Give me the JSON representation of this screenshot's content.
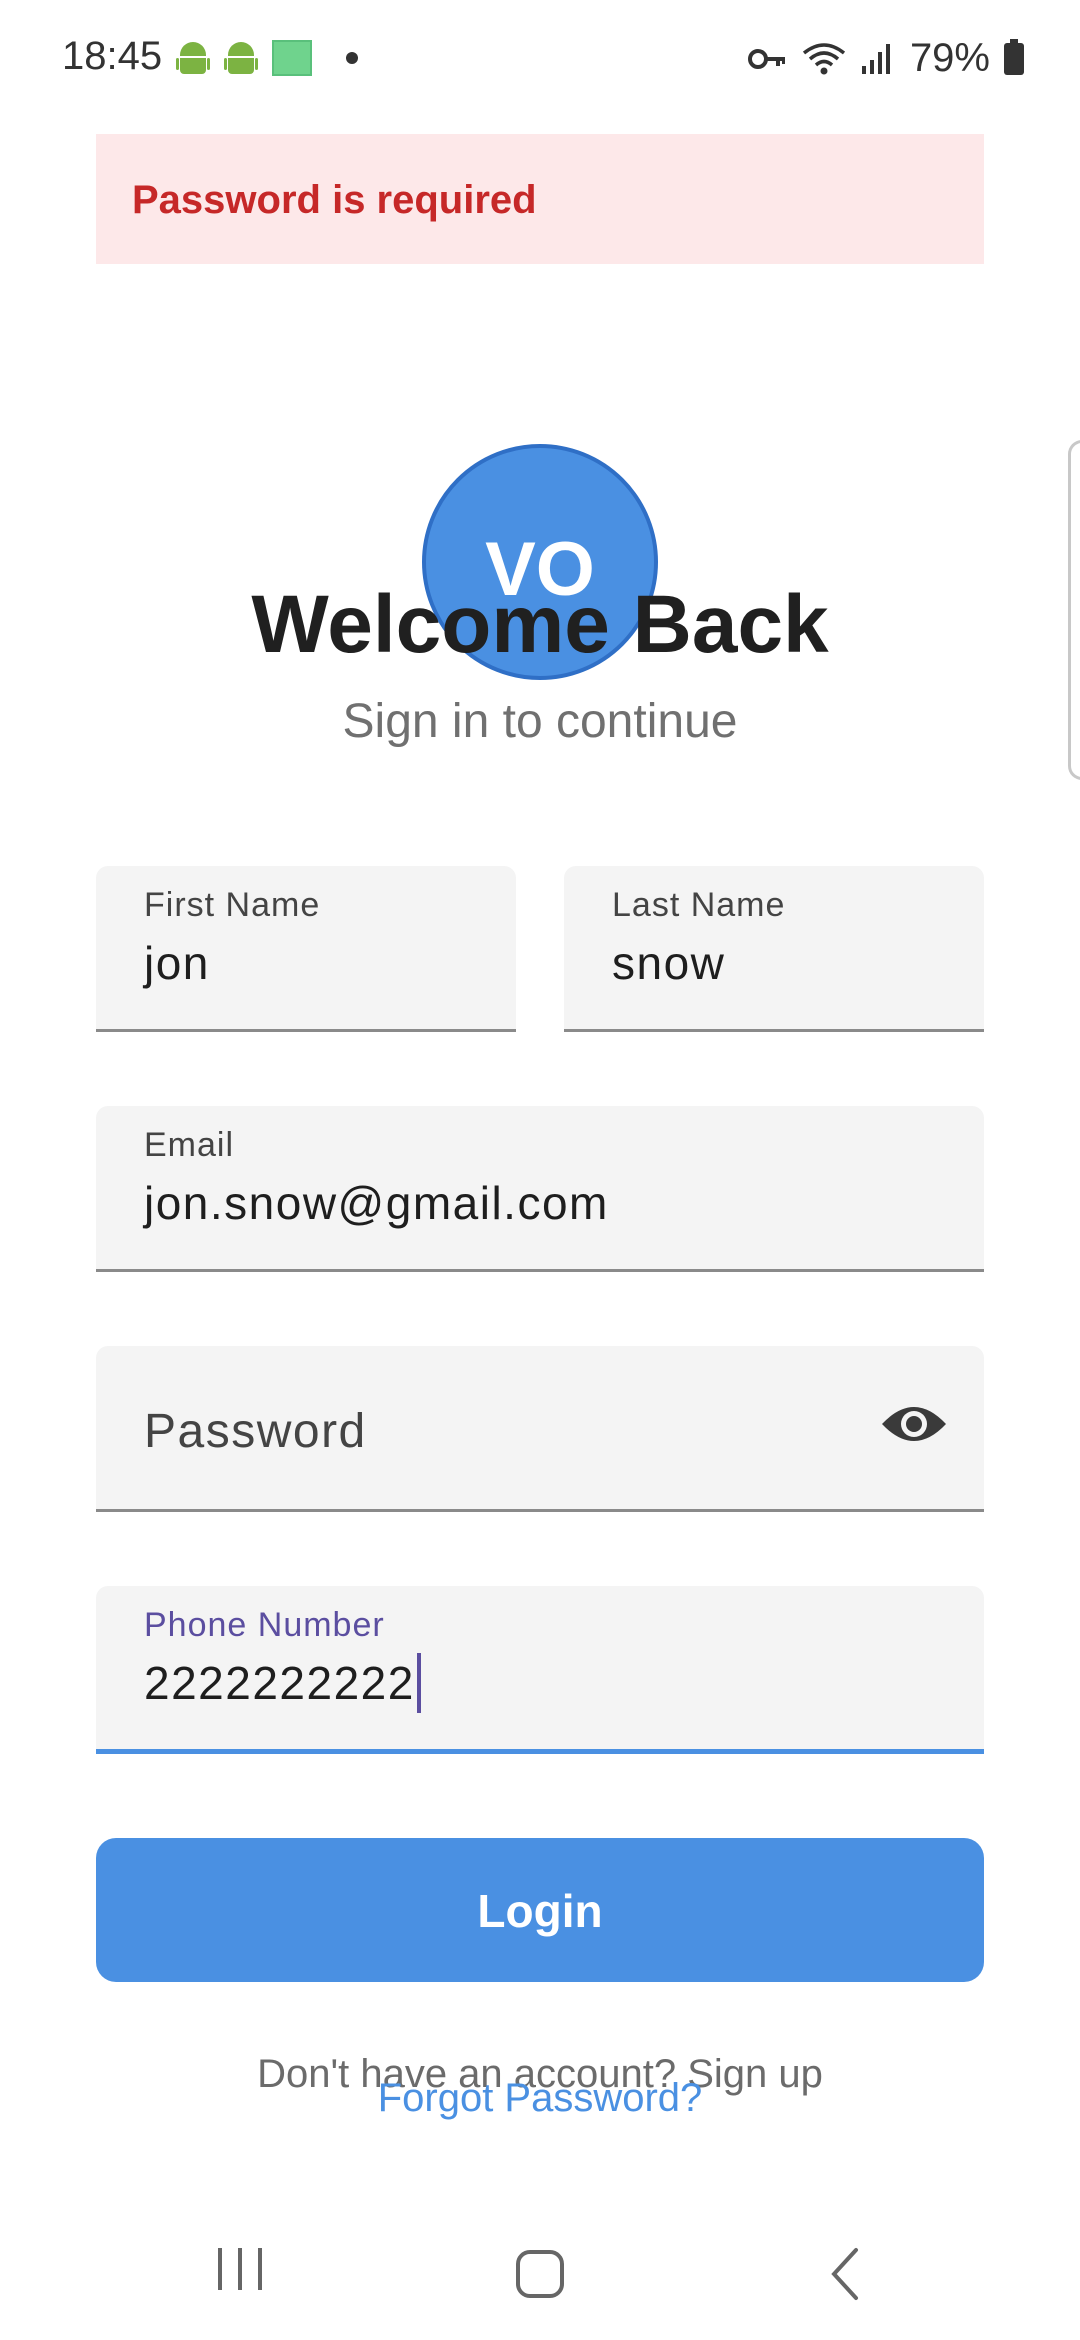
{
  "status_bar": {
    "time": "18:45",
    "battery": "79%",
    "icons": [
      "android-icon",
      "android-icon",
      "green-square-icon",
      "dot-icon",
      "key-icon",
      "wifi-icon",
      "signal-icon",
      "battery-icon"
    ]
  },
  "error_banner": {
    "message": "Password is required",
    "color": "#c62828",
    "background": "#fde8e9"
  },
  "avatar": {
    "initials": "VO",
    "color": "#4a90e2"
  },
  "header": {
    "title": "Welcome Back",
    "subtitle": "Sign in to continue"
  },
  "form": {
    "first_name": {
      "label": "First Name",
      "value": "jon"
    },
    "last_name": {
      "label": "Last Name",
      "value": "snow"
    },
    "email": {
      "label": "Email",
      "value": "jon.snow@gmail.com"
    },
    "password": {
      "label": "Password",
      "value": "",
      "visibility_icon": "eye-icon"
    },
    "phone": {
      "label": "Phone Number",
      "value": "2222222222",
      "focused": true
    }
  },
  "actions": {
    "login_label": "Login",
    "signup_text": "Don't have an account? Sign up",
    "forgot_password": "Forgot Password?"
  },
  "nav_bar": {
    "icons": [
      "recents-icon",
      "home-icon",
      "back-icon"
    ]
  },
  "colors": {
    "accent": "#4a90e2",
    "focus_label": "#5b4ea0"
  }
}
